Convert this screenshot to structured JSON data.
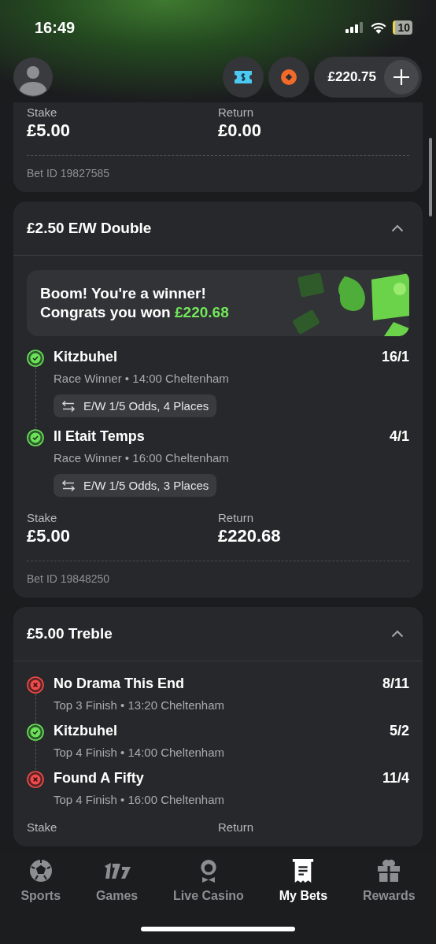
{
  "status_bar": {
    "time": "16:49",
    "battery": "10"
  },
  "header": {
    "balance": "£220.75"
  },
  "bets": [
    {
      "kind": "partial",
      "stake_label": "Stake",
      "stake": "£5.00",
      "return_label": "Return",
      "return": "£0.00",
      "bet_id": "Bet ID 19827585"
    },
    {
      "kind": "full",
      "title": "£2.50 E/W Double",
      "expanded": true,
      "banner": {
        "line1": "Boom! You're a winner!",
        "line2": "Congrats you won",
        "amount": "£220.68"
      },
      "legs": [
        {
          "won": true,
          "name": "Kitzbuhel",
          "odds": "16/1",
          "market": "Race Winner • 14:00 Cheltenham",
          "terms": "E/W 1/5 Odds, 4 Places"
        },
        {
          "won": true,
          "name": "Il Etait Temps",
          "odds": "4/1",
          "market": "Race Winner • 16:00 Cheltenham",
          "terms": "E/W 1/5 Odds, 3 Places"
        }
      ],
      "stake_label": "Stake",
      "stake": "£5.00",
      "return_label": "Return",
      "return": "£220.68",
      "bet_id": "Bet ID 19848250"
    },
    {
      "kind": "full",
      "title": "£5.00 Treble",
      "expanded": true,
      "legs": [
        {
          "won": false,
          "name": "No Drama This End",
          "odds": "8/11",
          "market": "Top 3 Finish • 13:20 Cheltenham"
        },
        {
          "won": true,
          "name": "Kitzbuhel",
          "odds": "5/2",
          "market": "Top 4 Finish • 14:00 Cheltenham"
        },
        {
          "won": false,
          "name": "Found A Fifty",
          "odds": "11/4",
          "market": "Top 4 Finish • 16:00 Cheltenham"
        }
      ],
      "stake_label": "Stake",
      "return_label": "Return"
    }
  ],
  "nav": [
    {
      "label": "Sports",
      "kind": "ball",
      "selected": false
    },
    {
      "label": "Games",
      "kind": "slots",
      "selected": false
    },
    {
      "label": "Live Casino",
      "kind": "dealer",
      "selected": false
    },
    {
      "label": "My Bets",
      "kind": "slip",
      "selected": true
    },
    {
      "label": "Rewards",
      "kind": "gift",
      "selected": false
    }
  ]
}
